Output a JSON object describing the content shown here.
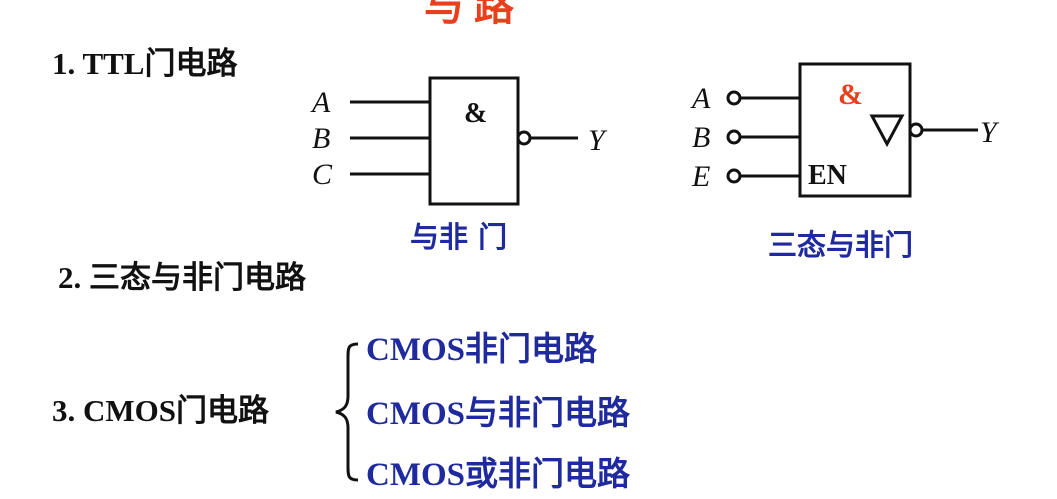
{
  "title_fragment": "与   路",
  "section1": {
    "heading": "1. TTL门电路"
  },
  "section2": {
    "heading": "2. 三态与非门电路"
  },
  "section3": {
    "heading": "3. CMOS门电路",
    "items": [
      "CMOS非门电路",
      "CMOS与非门电路",
      "CMOS或非门电路"
    ]
  },
  "nand_gate": {
    "inputs": [
      "A",
      "B",
      "C"
    ],
    "symbol": "&",
    "output": "Y",
    "caption": "与非 门"
  },
  "tristate_gate": {
    "inputs": [
      "A",
      "B",
      "E"
    ],
    "symbol": "&",
    "enable_label": "EN",
    "output": "Y",
    "caption": "三态与非门"
  },
  "colors": {
    "accent_red": "#e8401c",
    "blue": "#1f2a9e",
    "black": "#111111"
  }
}
